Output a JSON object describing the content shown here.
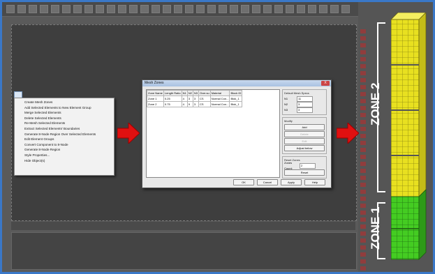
{
  "context_menu": {
    "items": [
      "Create Mesh Zones",
      "Add Selected Elements to New Element Group",
      "Merge Selected Elements",
      "Delete Selected Elements",
      "Re-Mesh Selected Elements",
      "Extract Selected Elements' Boundaries",
      "Generate 8-Node Region Over Selected Elements",
      "Edit Element Groups",
      "Convert Component to 8-Node",
      "Generate 8-Node Region",
      "Style Properties...",
      "Hide Object(s)"
    ]
  },
  "dialog": {
    "title": "Mesh Zones",
    "close_label": "X",
    "columns": [
      "Zone Name",
      "Length Ratio",
      "N1",
      "N2",
      "N3",
      "Over.su",
      "Material",
      "Block ID"
    ],
    "rows": [
      [
        "Zone 1",
        "0.25",
        "4",
        "3",
        "3",
        "CS",
        "Normal Con...",
        "Blok_1"
      ],
      [
        "Zone 2",
        "0.75",
        "4",
        "9",
        "3",
        "CS",
        "Normal Con...",
        "Blok_1"
      ]
    ],
    "default_specs": {
      "label": "Default Mesh Specs",
      "n1_label": "N1",
      "n1_value": "11",
      "n2_label": "N2",
      "n2_value": "3",
      "n3_label": "N3",
      "n3_value": "3"
    },
    "modify": {
      "label": "Modify",
      "add": "Add",
      "delete": "Delete",
      "edit": "Edit",
      "adjust": "Adjust below"
    },
    "reset_zones": {
      "label": "Reset Zones",
      "count_label": "Zones Count:",
      "count_value": "2",
      "reset": "Reset"
    },
    "buttons": {
      "ok": "OK",
      "cancel": "Cancel",
      "apply": "Apply",
      "help": "Help"
    }
  },
  "zones": {
    "zone2_label": "ZONE 2",
    "zone1_label": "ZONE 1",
    "zone2_color": "#e8e020",
    "zone1_color": "#44cc22"
  },
  "colors": {
    "arrow": "#e01010",
    "frame": "#3a78c8"
  }
}
